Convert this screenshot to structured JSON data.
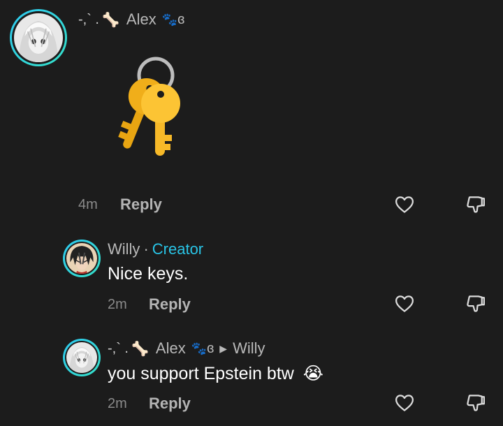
{
  "comment_main": {
    "prefix": "-,` .",
    "username": "Alex",
    "suffix": "ɞ",
    "time": "4m",
    "reply_label": "Reply"
  },
  "reply_1": {
    "username": "Willy",
    "separator": "·",
    "badge": "Creator",
    "text": "Nice keys.",
    "time": "2m",
    "reply_label": "Reply"
  },
  "reply_2": {
    "prefix": "-,` .",
    "username": "Alex",
    "suffix": "ɞ",
    "reply_to": "Willy",
    "text": "you support Epstein btw",
    "emoji": "😭",
    "time": "2m",
    "reply_label": "Reply"
  },
  "icons": {
    "like": "heart-outline-icon",
    "dislike": "thumbs-down-outline-icon",
    "sticker": "keys-sticker",
    "decor": [
      "bone-icon",
      "paw-icon"
    ]
  },
  "colors": {
    "background": "#1c1c1c",
    "creator_badge": "#29c4e6",
    "avatar_ring": "#2ec9f0",
    "key_gold": "#f7b928"
  }
}
